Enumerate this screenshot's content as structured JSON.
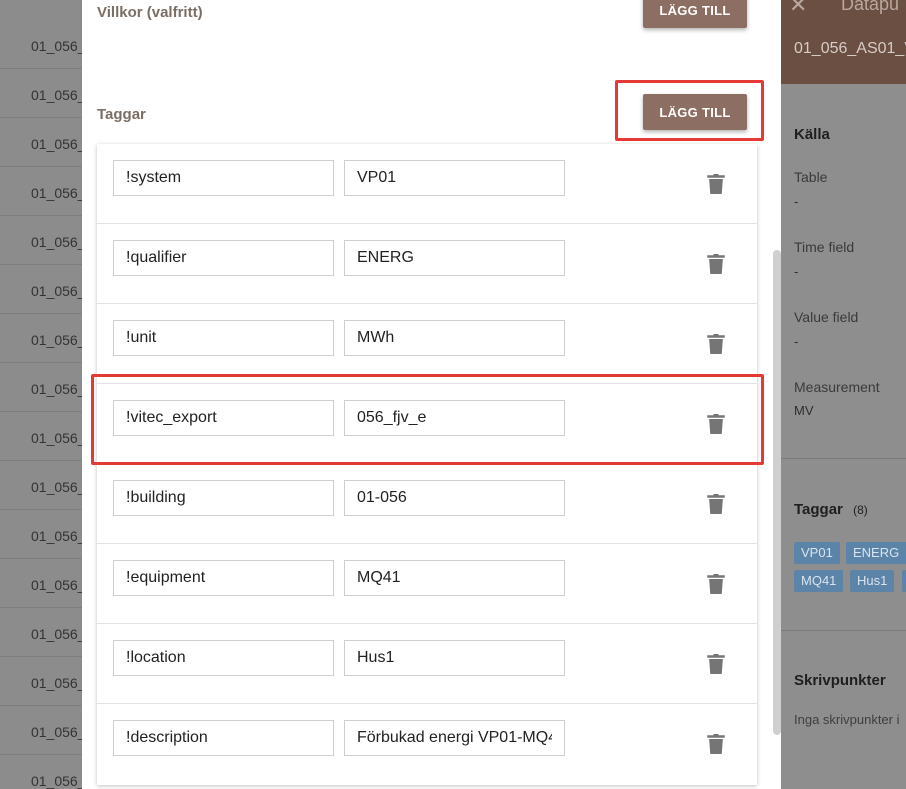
{
  "bg_list": {
    "rows": [
      "01_056_",
      "01_056_",
      "01_056_",
      "01_056_",
      "01_056_",
      "01_056_",
      "01_056_",
      "01_056_",
      "01_056_",
      "01_056_",
      "01_056_",
      "01_056_",
      "01_056_",
      "01_056_",
      "01_056_",
      "01_056_"
    ]
  },
  "conditions": {
    "title": "Villkor (valfritt)",
    "add_label": "LÄGG TILL"
  },
  "tags": {
    "title": "Taggar",
    "add_label": "LÄGG TILL",
    "rows": [
      {
        "key": "!system",
        "value": "VP01"
      },
      {
        "key": "!qualifier",
        "value": "ENERG"
      },
      {
        "key": "!unit",
        "value": "MWh"
      },
      {
        "key": "!vitec_export",
        "value": "056_fjv_e"
      },
      {
        "key": "!building",
        "value": "01-056"
      },
      {
        "key": "!equipment",
        "value": "MQ41"
      },
      {
        "key": "!location",
        "value": "Hus1"
      },
      {
        "key": "!description",
        "value": "Förbukad energi VP01-MQ4"
      }
    ]
  },
  "right_panel": {
    "close": "✕",
    "header": "Datapu",
    "subtitle": "01_056_AS01_V",
    "source_title": "Källa",
    "table_label": "Table",
    "table_value": "-",
    "time_label": "Time field",
    "time_value": "-",
    "value_label": "Value field",
    "value_value": "-",
    "measurement_label": "Measurement",
    "measurement_value": "MV",
    "tags_title": "Taggar",
    "tags_count": "(8)",
    "chips": [
      "VP01",
      "ENERG",
      "MQ41",
      "Hus1"
    ],
    "write_title": "Skrivpunkter",
    "write_empty": "Inga skrivpunkter i"
  },
  "colors": {
    "button": "#8d6e63",
    "highlight": "#e53935",
    "chip": "#5b84a8",
    "header": "#6b4f43"
  }
}
